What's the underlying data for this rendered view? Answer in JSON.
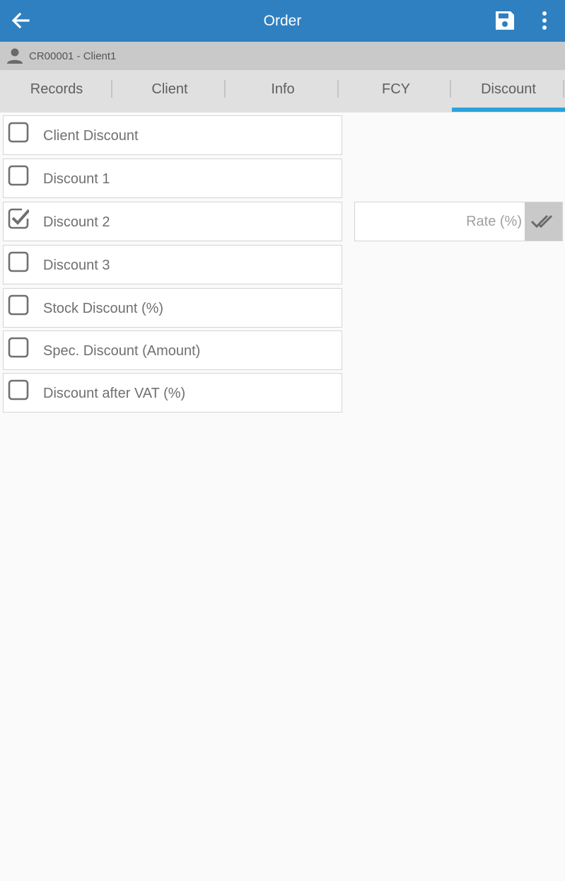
{
  "appbar": {
    "title": "Order",
    "back_icon": "arrow-left-icon",
    "save_icon": "floppy-disk-icon",
    "more_icon": "more-vertical-icon",
    "color": "#2f80c0"
  },
  "client": {
    "icon": "person-icon",
    "text": "CR00001 - Client1"
  },
  "tabs": [
    {
      "label": "Records"
    },
    {
      "label": "Client"
    },
    {
      "label": "Info"
    },
    {
      "label": "FCY"
    },
    {
      "label": "Discount",
      "selected": true
    }
  ],
  "accent_color": "#2aa3dc",
  "discounts": [
    {
      "label": "Client Discount",
      "checked": false
    },
    {
      "label": "Discount 1",
      "checked": false
    },
    {
      "label": "Discount 2",
      "checked": true
    },
    {
      "label": "Discount 3",
      "checked": false
    },
    {
      "label": "Stock Discount (%)",
      "checked": false
    },
    {
      "label": "Spec. Discount (Amount)",
      "checked": false
    },
    {
      "label": "Discount after VAT (%)",
      "checked": false
    }
  ],
  "rate": {
    "placeholder": "Rate (%)",
    "value": "",
    "confirm_icon": "double-check-icon"
  }
}
